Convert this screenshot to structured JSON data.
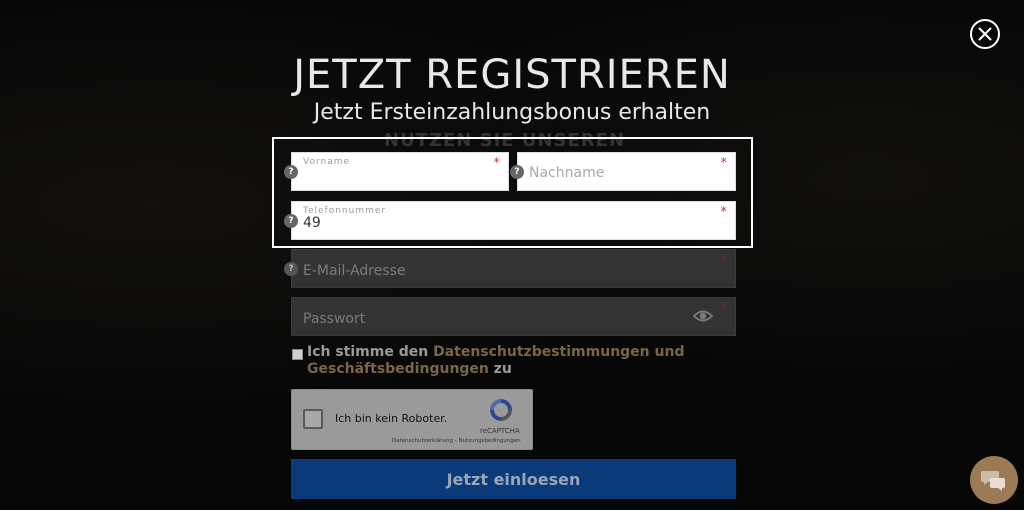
{
  "modal": {
    "title": "JETZT REGISTRIEREN",
    "subtitle": "Jetzt Ersteinzahlungsbonus erhalten",
    "behind_text": "NUTZEN SIE UNSEREN"
  },
  "form": {
    "firstname": {
      "label": "Vorname",
      "value": "",
      "required": "*"
    },
    "lastname": {
      "placeholder": "Nachname",
      "required": "*"
    },
    "phone": {
      "label": "Telefonnummer",
      "value": "49",
      "required": "*"
    },
    "email": {
      "placeholder": "E-Mail-Adresse",
      "required": "*"
    },
    "password": {
      "placeholder": "Passwort",
      "required": "*"
    },
    "help_symbol": "?",
    "consent": {
      "prefix": "Ich stimme den ",
      "link": "Datenschutzbestimmungen und Geschäftsbedingungen",
      "suffix": " zu"
    },
    "recaptcha": {
      "label": "Ich bin kein Roboter.",
      "brand": "reCAPTCHA",
      "links": "Datenschutzerklärung - Nutzungsbedingungen"
    },
    "submit_label": "Jetzt einloesen"
  },
  "colors": {
    "submit_bg": "#0a3a7a",
    "link": "#7a6548",
    "required": "#c0392b",
    "chat_bg": "#9c7a55"
  },
  "icons": [
    "close-icon",
    "help-icon",
    "eye-icon",
    "recaptcha-logo-icon",
    "chat-icon"
  ]
}
